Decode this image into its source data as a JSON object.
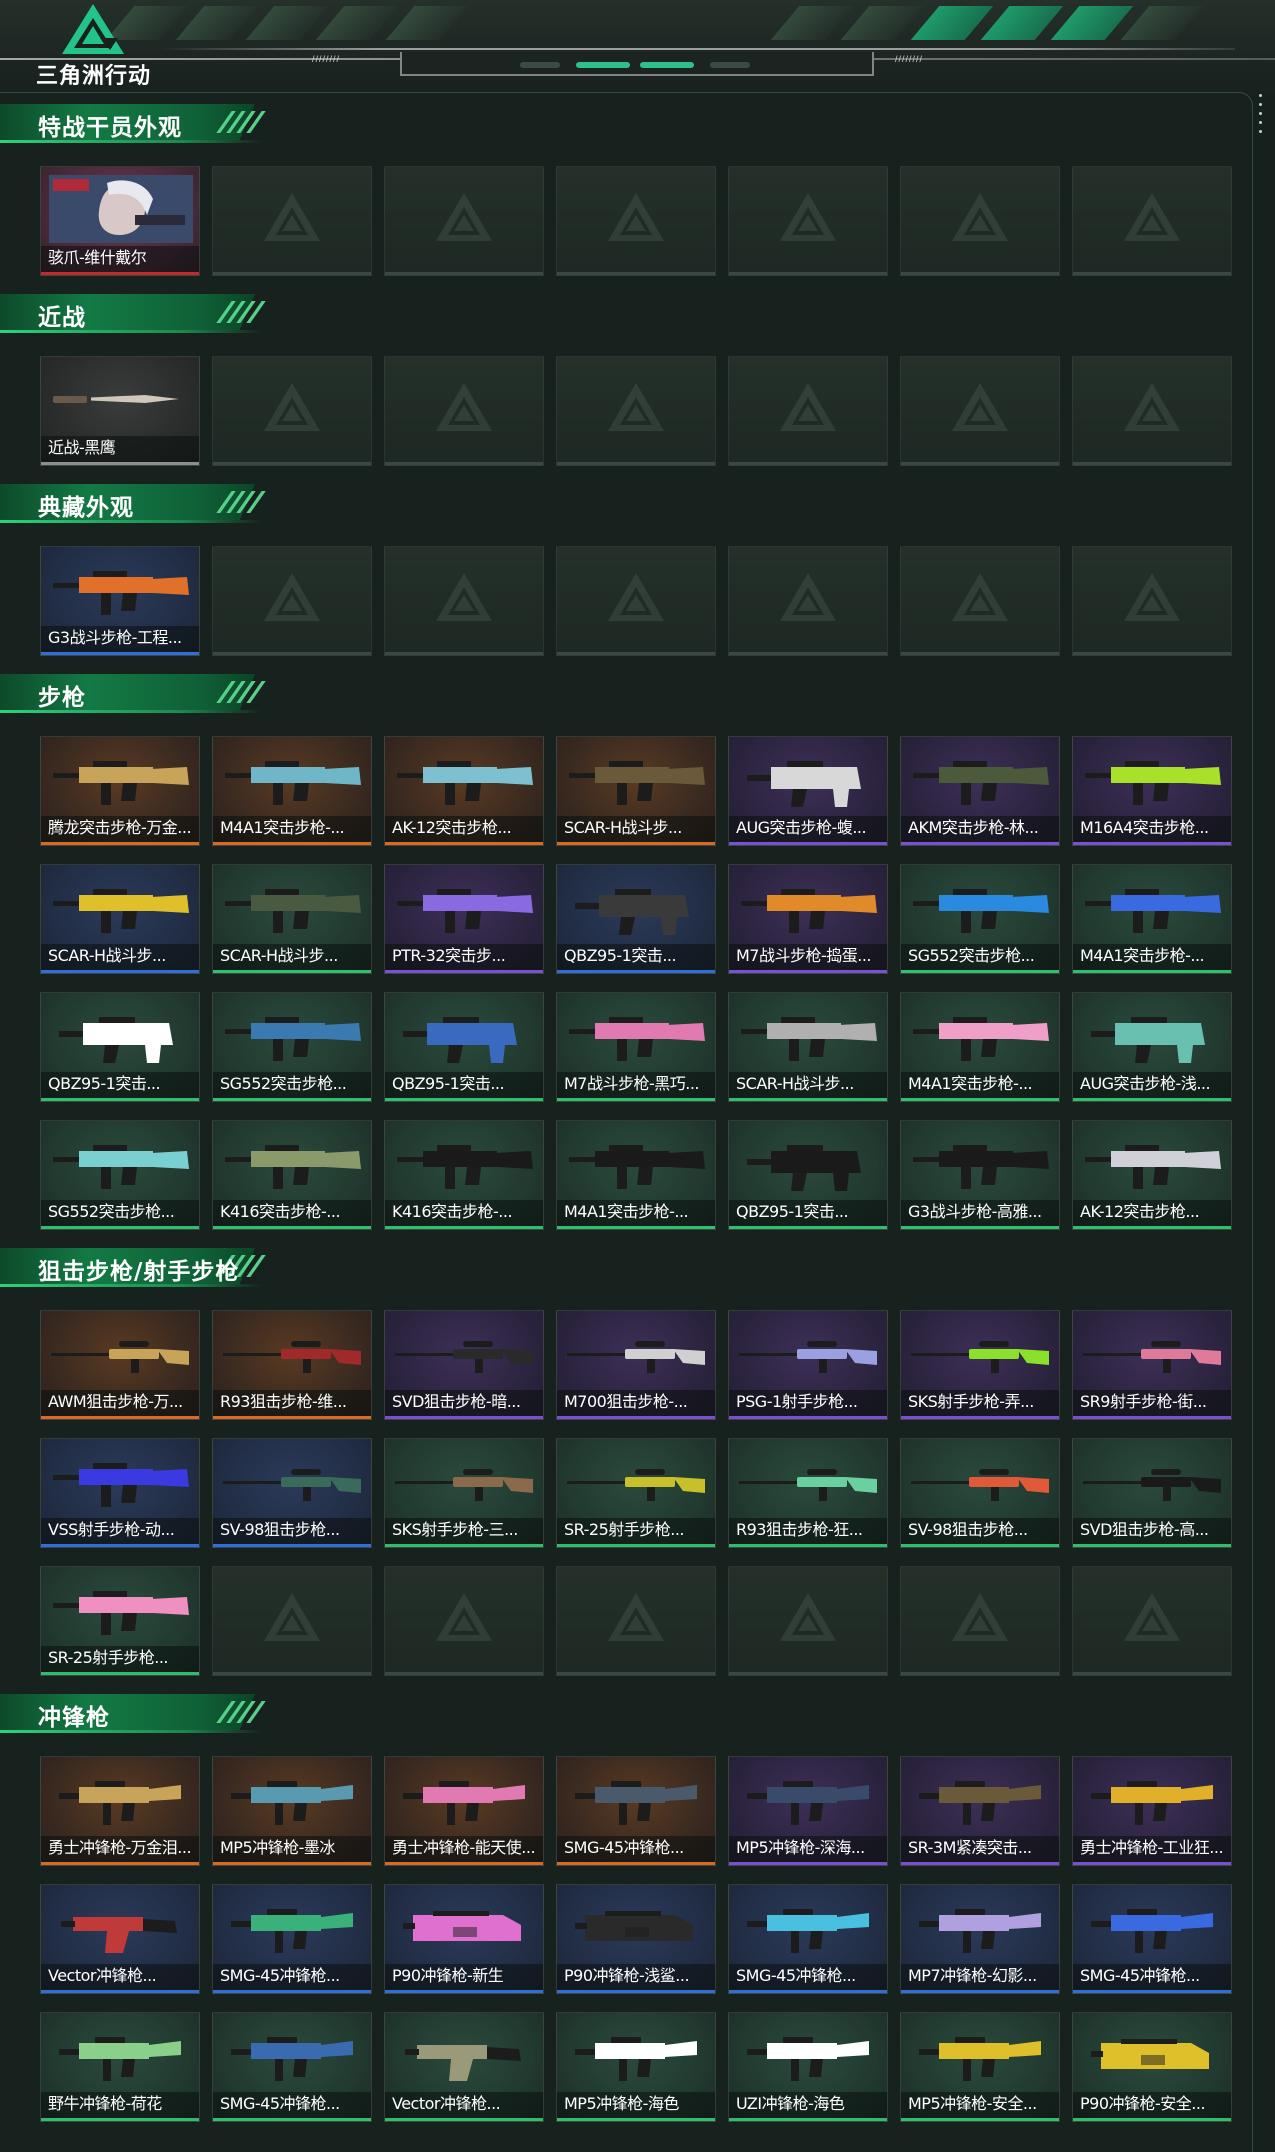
{
  "header": {
    "logo_text": "三角洲行动",
    "ticks_left": "////////",
    "ticks_right": "////////"
  },
  "colors": {
    "rarity": {
      "red": "#c22a2a",
      "orange": "#d96a1f",
      "purple": "#7a4fd1",
      "blue": "#2f6fd8",
      "green": "#2fbf6a"
    },
    "accent": "#1f9a6a"
  },
  "sections": [
    {
      "title": "特战干员外观",
      "items": [
        {
          "name": "骇爪-维什戴尔",
          "rarity": "red",
          "kind": "operator"
        },
        null,
        null,
        null,
        null,
        null,
        null
      ]
    },
    {
      "title": "近战",
      "items": [
        {
          "name": "近战-黑鹰",
          "rarity": "gray",
          "kind": "knife"
        },
        null,
        null,
        null,
        null,
        null,
        null
      ]
    },
    {
      "title": "典藏外观",
      "items": [
        {
          "name": "G3战斗步枪-工程...",
          "rarity": "blue",
          "kind": "rifle",
          "color": "#e0702a"
        },
        null,
        null,
        null,
        null,
        null,
        null
      ]
    },
    {
      "title": "步枪",
      "items": [
        {
          "name": "腾龙突击步枪-万金...",
          "rarity": "orange",
          "kind": "rifle",
          "color": "#c8a45a"
        },
        {
          "name": "M4A1突击步枪-...",
          "rarity": "orange",
          "kind": "rifle",
          "color": "#6fb7c8"
        },
        {
          "name": "AK-12突击步枪...",
          "rarity": "orange",
          "kind": "rifle",
          "color": "#7ec0d0"
        },
        {
          "name": "SCAR-H战斗步...",
          "rarity": "orange",
          "kind": "rifle",
          "color": "#6a5a3a"
        },
        {
          "name": "AUG突击步枪-蝮...",
          "rarity": "purple",
          "kind": "bullpup",
          "color": "#d8d8d8"
        },
        {
          "name": "AKM突击步枪-林...",
          "rarity": "purple",
          "kind": "rifle",
          "color": "#4a5a3a"
        },
        {
          "name": "M16A4突击步枪...",
          "rarity": "purple",
          "kind": "rifle",
          "color": "#a8e02a"
        },
        {
          "name": "SCAR-H战斗步...",
          "rarity": "blue",
          "kind": "rifle",
          "color": "#e0c02a"
        },
        {
          "name": "SCAR-H战斗步...",
          "rarity": "green",
          "kind": "rifle",
          "color": "#4a5a40"
        },
        {
          "name": "PTR-32突击步...",
          "rarity": "purple",
          "kind": "rifle",
          "color": "#8a6ae0"
        },
        {
          "name": "QBZ95-1突击...",
          "rarity": "blue",
          "kind": "bullpup",
          "color": "#3a3a3a"
        },
        {
          "name": "M7战斗步枪-捣蛋...",
          "rarity": "purple",
          "kind": "rifle",
          "color": "#e08a2a"
        },
        {
          "name": "SG552突击步枪...",
          "rarity": "green",
          "kind": "rifle",
          "color": "#2a8ae0"
        },
        {
          "name": "M4A1突击步枪-...",
          "rarity": "green",
          "kind": "rifle",
          "color": "#3a6ae0"
        },
        {
          "name": "QBZ95-1突击...",
          "rarity": "green",
          "kind": "bullpup",
          "color": "#ffffff"
        },
        {
          "name": "SG552突击步枪...",
          "rarity": "green",
          "kind": "rifle",
          "color": "#3a7ab0"
        },
        {
          "name": "QBZ95-1突击...",
          "rarity": "green",
          "kind": "bullpup",
          "color": "#3a6ac0"
        },
        {
          "name": "M7战斗步枪-黑巧...",
          "rarity": "green",
          "kind": "rifle",
          "color": "#e07ab0"
        },
        {
          "name": "SCAR-H战斗步...",
          "rarity": "green",
          "kind": "rifle",
          "color": "#b0b0b0"
        },
        {
          "name": "M4A1突击步枪-...",
          "rarity": "green",
          "kind": "rifle",
          "color": "#f0a0c8"
        },
        {
          "name": "AUG突击步枪-浅...",
          "rarity": "green",
          "kind": "bullpup",
          "color": "#6ac0b0"
        },
        {
          "name": "SG552突击步枪...",
          "rarity": "green",
          "kind": "rifle",
          "color": "#7ad0d0"
        },
        {
          "name": "K416突击步枪-...",
          "rarity": "green",
          "kind": "rifle",
          "color": "#8a9a6a"
        },
        {
          "name": "K416突击步枪-...",
          "rarity": "green",
          "kind": "rifle",
          "color": "#1a1a1a"
        },
        {
          "name": "M4A1突击步枪-...",
          "rarity": "green",
          "kind": "rifle",
          "color": "#1a1a1a"
        },
        {
          "name": "QBZ95-1突击...",
          "rarity": "green",
          "kind": "bullpup",
          "color": "#1a1a1a"
        },
        {
          "name": "G3战斗步枪-高雅...",
          "rarity": "green",
          "kind": "rifle",
          "color": "#1a1a1a"
        },
        {
          "name": "AK-12突击步枪...",
          "rarity": "green",
          "kind": "rifle",
          "color": "#d0d0d8"
        }
      ]
    },
    {
      "title": "狙击步枪/射手步枪",
      "items": [
        {
          "name": "AWM狙击步枪-万...",
          "rarity": "orange",
          "kind": "sniper",
          "color": "#c8a45a"
        },
        {
          "name": "R93狙击步枪-维...",
          "rarity": "orange",
          "kind": "sniper",
          "color": "#a02a2a"
        },
        {
          "name": "SVD狙击步枪-暗...",
          "rarity": "purple",
          "kind": "sniper",
          "color": "#2a2a2a"
        },
        {
          "name": "M700狙击步枪-...",
          "rarity": "purple",
          "kind": "sniper",
          "color": "#d0d0d0"
        },
        {
          "name": "PSG-1射手步枪...",
          "rarity": "purple",
          "kind": "sniper",
          "color": "#9aa0e0"
        },
        {
          "name": "SKS射手步枪-弄...",
          "rarity": "purple",
          "kind": "sniper",
          "color": "#8ae02a"
        },
        {
          "name": "SR9射手步枪-街...",
          "rarity": "purple",
          "kind": "sniper",
          "color": "#e07a9a"
        },
        {
          "name": "VSS射手步枪-动...",
          "rarity": "blue",
          "kind": "rifle",
          "color": "#3a3ae0"
        },
        {
          "name": "SV-98狙击步枪...",
          "rarity": "blue",
          "kind": "sniper",
          "color": "#3a6a5a"
        },
        {
          "name": "SKS射手步枪-三...",
          "rarity": "green",
          "kind": "sniper",
          "color": "#8a6a4a"
        },
        {
          "name": "SR-25射手步枪...",
          "rarity": "green",
          "kind": "sniper",
          "color": "#c8c02a"
        },
        {
          "name": "R93狙击步枪-狂...",
          "rarity": "green",
          "kind": "sniper",
          "color": "#6ad0a0"
        },
        {
          "name": "SV-98狙击步枪...",
          "rarity": "green",
          "kind": "sniper",
          "color": "#e05a3a"
        },
        {
          "name": "SVD狙击步枪-高...",
          "rarity": "green",
          "kind": "sniper",
          "color": "#1a1a1a"
        },
        {
          "name": "SR-25射手步枪...",
          "rarity": "green",
          "kind": "rifle",
          "color": "#f090c0"
        },
        null,
        null,
        null,
        null,
        null,
        null
      ]
    },
    {
      "title": "冲锋枪",
      "items": [
        {
          "name": "勇士冲锋枪-万金泪...",
          "rarity": "orange",
          "kind": "smg",
          "color": "#c8a45a"
        },
        {
          "name": "MP5冲锋枪-墨冰",
          "rarity": "orange",
          "kind": "smg",
          "color": "#5a9ab0"
        },
        {
          "name": "勇士冲锋枪-能天使...",
          "rarity": "orange",
          "kind": "smg",
          "color": "#e07ab0"
        },
        {
          "name": "SMG-45冲锋枪...",
          "rarity": "orange",
          "kind": "smg",
          "color": "#4a5a6a"
        },
        {
          "name": "MP5冲锋枪-深海...",
          "rarity": "purple",
          "kind": "smg",
          "color": "#3a4a6a"
        },
        {
          "name": "SR-3M紧凑突击...",
          "rarity": "purple",
          "kind": "smg",
          "color": "#6a5a3a"
        },
        {
          "name": "勇士冲锋枪-工业狂...",
          "rarity": "purple",
          "kind": "smg",
          "color": "#e0b02a"
        },
        {
          "name": "Vector冲锋枪...",
          "rarity": "blue",
          "kind": "vector",
          "color": "#c03a3a"
        },
        {
          "name": "SMG-45冲锋枪...",
          "rarity": "blue",
          "kind": "smg",
          "color": "#3ab07a"
        },
        {
          "name": "P90冲锋枪-新生",
          "rarity": "blue",
          "kind": "p90",
          "color": "#e070d0"
        },
        {
          "name": "P90冲锋枪-浅鲨...",
          "rarity": "blue",
          "kind": "p90",
          "color": "#2a2a2a"
        },
        {
          "name": "SMG-45冲锋枪...",
          "rarity": "blue",
          "kind": "smg",
          "color": "#4ac0e0"
        },
        {
          "name": "MP7冲锋枪-幻影...",
          "rarity": "blue",
          "kind": "smg",
          "color": "#b0a0e0"
        },
        {
          "name": "SMG-45冲锋枪...",
          "rarity": "blue",
          "kind": "smg",
          "color": "#3a6ae0"
        },
        {
          "name": "野牛冲锋枪-荷花",
          "rarity": "green",
          "kind": "smg",
          "color": "#8ad08a"
        },
        {
          "name": "SMG-45冲锋枪...",
          "rarity": "green",
          "kind": "smg",
          "color": "#3a6ab0"
        },
        {
          "name": "Vector冲锋枪...",
          "rarity": "green",
          "kind": "vector",
          "color": "#9a9a7a"
        },
        {
          "name": "MP5冲锋枪-海色",
          "rarity": "green",
          "kind": "smg",
          "color": "#ffffff"
        },
        {
          "name": "UZI冲锋枪-海色",
          "rarity": "green",
          "kind": "smg",
          "color": "#ffffff"
        },
        {
          "name": "MP5冲锋枪-安全...",
          "rarity": "green",
          "kind": "smg",
          "color": "#e0c02a"
        },
        {
          "name": "P90冲锋枪-安全...",
          "rarity": "green",
          "kind": "p90",
          "color": "#e0c02a"
        }
      ]
    }
  ]
}
